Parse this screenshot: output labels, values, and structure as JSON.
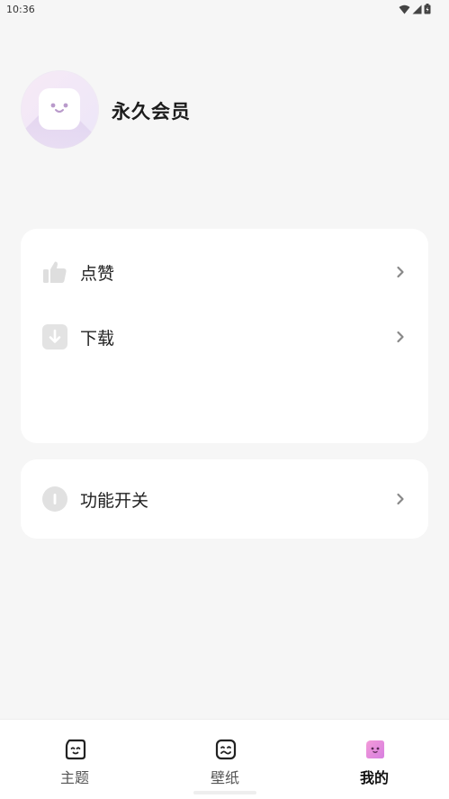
{
  "status_bar": {
    "time": "10:36"
  },
  "profile": {
    "name": "永久会员"
  },
  "menu": {
    "items": [
      {
        "label": "点赞",
        "icon": "thumbs-up-icon"
      },
      {
        "label": "下载",
        "icon": "download-icon"
      }
    ],
    "features": {
      "label": "功能开关",
      "icon": "toggle-icon"
    }
  },
  "bottom_nav": {
    "tabs": [
      {
        "label": "主题",
        "icon": "theme-face-icon",
        "active": false
      },
      {
        "label": "壁纸",
        "icon": "wallpaper-face-icon",
        "active": false
      },
      {
        "label": "我的",
        "icon": "profile-face-icon",
        "active": true
      }
    ]
  },
  "colors": {
    "background": "#f6f6f6",
    "card": "#ffffff",
    "active_accent": "#e87fd6"
  }
}
